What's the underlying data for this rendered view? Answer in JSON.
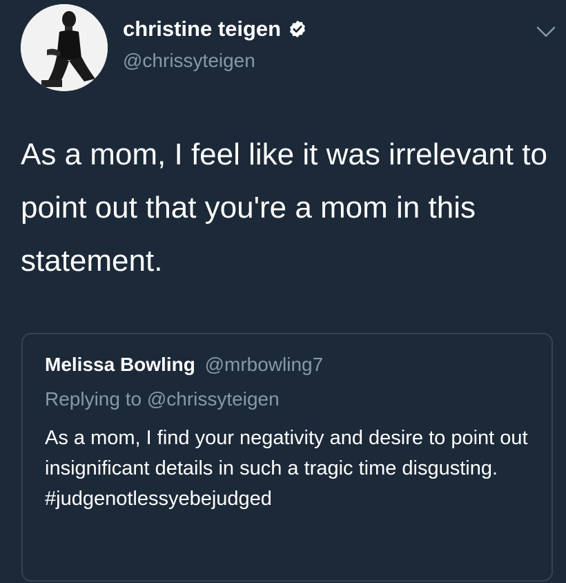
{
  "author": {
    "name": "christine teigen",
    "handle": "@chrissyteigen",
    "verified": true
  },
  "tweet": {
    "text": "As a mom, I feel like it was irrelevant to point out that you're a mom in this statement."
  },
  "quoted_tweet": {
    "name": "Melissa Bowling",
    "handle": "@mrbowling7",
    "replying_to": "Replying to @chrissyteigen",
    "text": "As a mom, I find your negativity and desire to point out insignificant details in such a tragic time disgusting. #judgenotlessyebejudged"
  },
  "icons": {
    "verified": "verified-badge-icon",
    "menu": "chevron-down-icon"
  },
  "colors": {
    "background": "#1c2938",
    "primary_text": "#ffffff",
    "secondary_text": "#8899a6",
    "border": "#38444d"
  }
}
